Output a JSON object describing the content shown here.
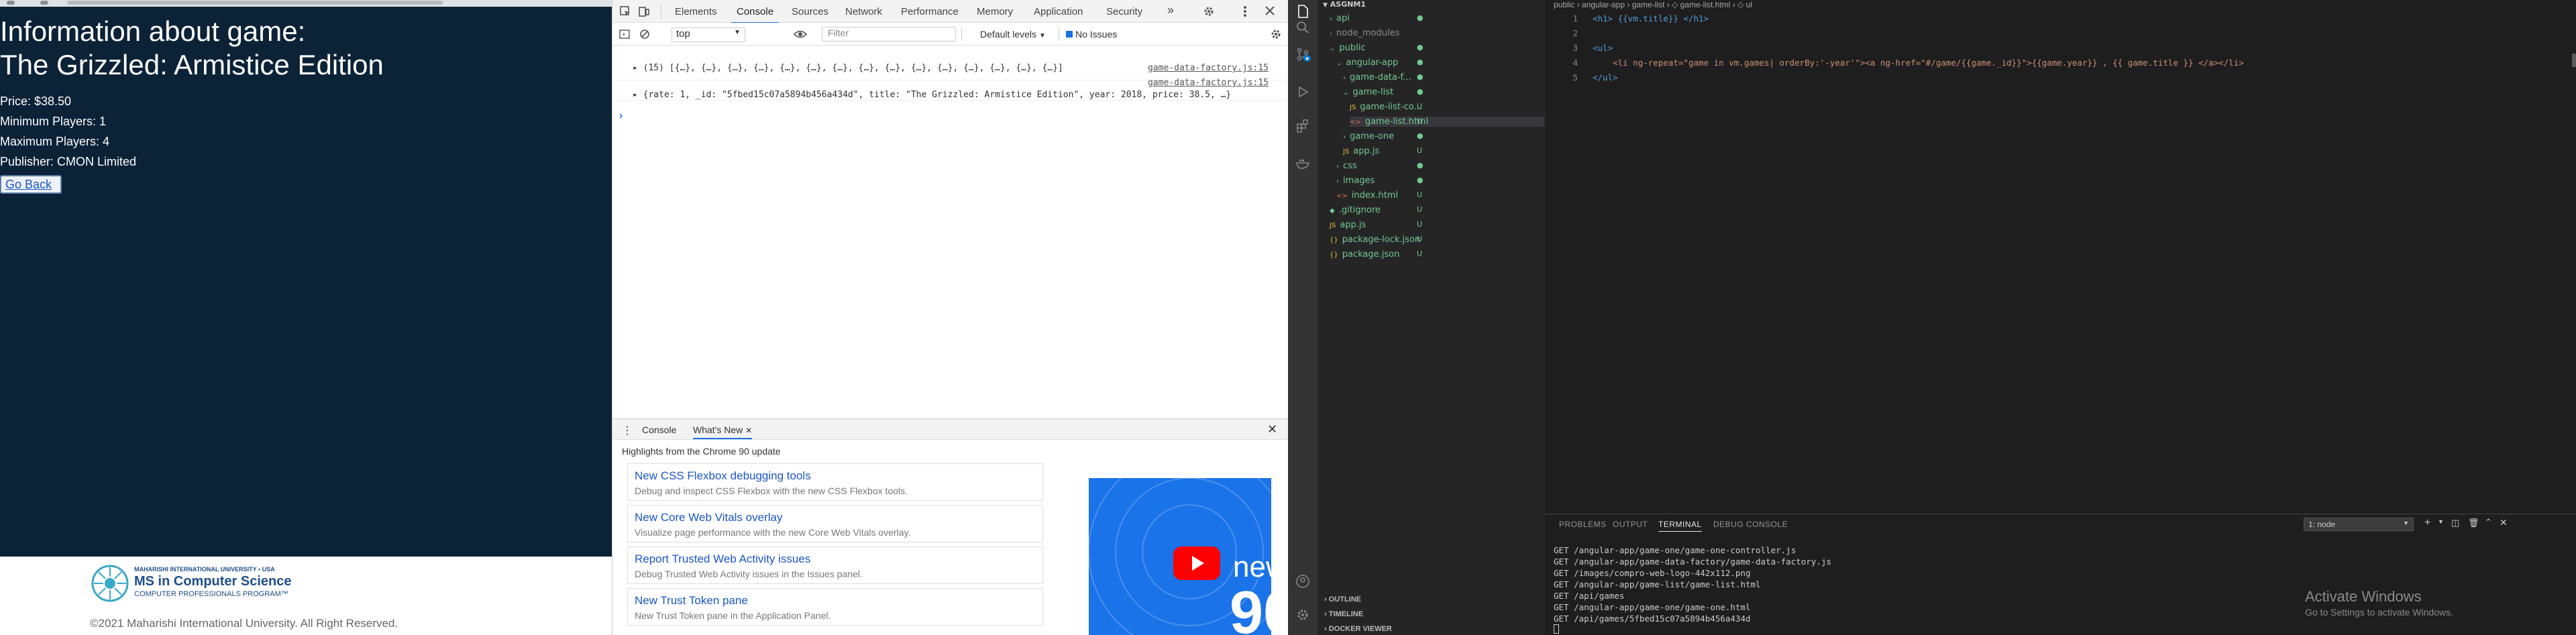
{
  "browser": {
    "title_line1": "Information about game:",
    "title_line2": "The Grizzled: Armistice Edition",
    "price": "Price: $38.50",
    "min_players": "Minimum Players: 1",
    "max_players": "Maximum Players: 4",
    "publisher": "Publisher: CMON Limited",
    "go_back": "Go Back",
    "footer": {
      "logo_top": "MAHARISHI INTERNATIONAL UNIVERSITY • USA",
      "logo_main": "MS in Computer Science",
      "logo_sub": "COMPUTER PROFESSIONALS PROGRAM™",
      "copyright": "©2021 Maharishi International University. All Right Reserved."
    }
  },
  "devtools": {
    "tabs": [
      "Elements",
      "Console",
      "Sources",
      "Network",
      "Performance",
      "Memory",
      "Application",
      "Security"
    ],
    "more": "»",
    "context": "top",
    "filter_placeholder": "Filter",
    "levels": "Default levels",
    "issues": "No Issues",
    "log": [
      {
        "text": "▸ (15) [{…}, {…}, {…}, {…}, {…}, {…}, {…}, {…}, {…}, {…}, {…}, {…}, {…}, {…}, {…}]",
        "source": "game-data-factory.js:15"
      },
      {
        "text": "▸ {rate: 1, _id: \"5fbed15c07a5894b456a434d\", title: \"The Grizzled: Armistice Edition\", year: 2018, price: 38.5, …}",
        "source": "game-data-factory.js:15"
      }
    ],
    "prompt": "›",
    "drawer_tabs": [
      "Console",
      "What's New"
    ],
    "highlights": "Highlights from the Chrome 90 update",
    "cards": [
      {
        "title": "New CSS Flexbox debugging tools",
        "desc": "Debug and inspect CSS Flexbox with the new CSS Flexbox tools."
      },
      {
        "title": "New Core Web Vitals overlay",
        "desc": "Visualize page performance with the new Core Web Vitals overlay."
      },
      {
        "title": "Report Trusted Web Activity issues",
        "desc": "Debug Trusted Web Activity issues in the Issues panel."
      },
      {
        "title": "New Trust Token pane",
        "desc": "New Trust Token pane in the Application Panel."
      }
    ],
    "promo_text": "new",
    "promo_num": "90"
  },
  "vscode": {
    "explorer_root": "ASGNM1",
    "breadcrumb": "public › angular-app › game-list › ◇ game-list.html › ◇ ul",
    "tree": [
      {
        "label": "api",
        "indent": 1,
        "kind": "folder",
        "color": "#73c991",
        "badge": "●"
      },
      {
        "label": "node_modules",
        "indent": 1,
        "kind": "folder",
        "color": "#8c8c8c",
        "badge": ""
      },
      {
        "label": "public",
        "indent": 1,
        "kind": "folder-open",
        "color": "#73c991",
        "badge": "●"
      },
      {
        "label": "angular-app",
        "indent": 2,
        "kind": "folder-open",
        "color": "#73c991",
        "badge": "●"
      },
      {
        "label": "game-data-f...",
        "indent": 3,
        "kind": "folder",
        "color": "#73c991",
        "badge": "●"
      },
      {
        "label": "game-list",
        "indent": 3,
        "kind": "folder-open",
        "color": "#73c991",
        "badge": "●"
      },
      {
        "label": "game-list-co...",
        "indent": 4,
        "kind": "js",
        "color": "#73c991",
        "badge": "U"
      },
      {
        "label": "game-list.html",
        "indent": 4,
        "kind": "html",
        "color": "#73c991",
        "badge": "U"
      },
      {
        "label": "game-one",
        "indent": 3,
        "kind": "folder",
        "color": "#73c991",
        "badge": "●"
      },
      {
        "label": "app.js",
        "indent": 3,
        "kind": "js",
        "color": "#73c991",
        "badge": "U"
      },
      {
        "label": "css",
        "indent": 2,
        "kind": "folder",
        "color": "#73c991",
        "badge": "●"
      },
      {
        "label": "images",
        "indent": 2,
        "kind": "folder",
        "color": "#73c991",
        "badge": "●"
      },
      {
        "label": "index.html",
        "indent": 2,
        "kind": "html",
        "color": "#73c991",
        "badge": "U"
      },
      {
        "label": ".gitignore",
        "indent": 1,
        "kind": "file",
        "color": "#73c991",
        "badge": "U"
      },
      {
        "label": "app.js",
        "indent": 1,
        "kind": "js",
        "color": "#73c991",
        "badge": "U"
      },
      {
        "label": "package-lock.json",
        "indent": 1,
        "kind": "json",
        "color": "#73c991",
        "badge": "U"
      },
      {
        "label": "package.json",
        "indent": 1,
        "kind": "json",
        "color": "#73c991",
        "badge": "U"
      }
    ],
    "outline_sections": [
      "OUTLINE",
      "TIMELINE",
      "DOCKER VIEWER"
    ],
    "code_lines": [
      "<h1> {{vm.title}} </h1>",
      "",
      "<ul>",
      "    <li ng-repeat=\"game in vm.games| orderBy:'-year'\"><a ng-href=\"#/game/{{game._id}}\">{{game.year}} , {{ game.title }} </a></li>",
      "</ul>"
    ],
    "panel_tabs": [
      "PROBLEMS",
      "OUTPUT",
      "TERMINAL",
      "DEBUG CONSOLE"
    ],
    "terminal_select": "1: node",
    "terminal": [
      "GET /angular-app/game-one/game-one-controller.js",
      "GET /angular-app/game-data-factory/game-data-factory.js",
      "GET /images/compro-web-logo-442x112.png",
      "GET /angular-app/game-list/game-list.html",
      "GET /api/games",
      "GET /angular-app/game-one/game-one.html",
      "GET /api/games/5fbed15c07a5894b456a434d"
    ],
    "activate_title": "Activate Windows",
    "activate_sub": "Go to Settings to activate Windows."
  }
}
